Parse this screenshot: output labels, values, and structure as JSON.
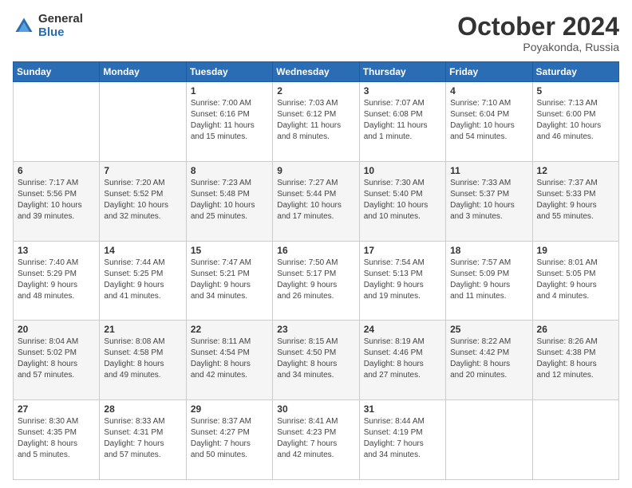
{
  "logo": {
    "general": "General",
    "blue": "Blue"
  },
  "header": {
    "month": "October 2024",
    "location": "Poyakonda, Russia"
  },
  "weekdays": [
    "Sunday",
    "Monday",
    "Tuesday",
    "Wednesday",
    "Thursday",
    "Friday",
    "Saturday"
  ],
  "weeks": [
    [
      {
        "day": "",
        "info": ""
      },
      {
        "day": "",
        "info": ""
      },
      {
        "day": "1",
        "info": "Sunrise: 7:00 AM\nSunset: 6:16 PM\nDaylight: 11 hours\nand 15 minutes."
      },
      {
        "day": "2",
        "info": "Sunrise: 7:03 AM\nSunset: 6:12 PM\nDaylight: 11 hours\nand 8 minutes."
      },
      {
        "day": "3",
        "info": "Sunrise: 7:07 AM\nSunset: 6:08 PM\nDaylight: 11 hours\nand 1 minute."
      },
      {
        "day": "4",
        "info": "Sunrise: 7:10 AM\nSunset: 6:04 PM\nDaylight: 10 hours\nand 54 minutes."
      },
      {
        "day": "5",
        "info": "Sunrise: 7:13 AM\nSunset: 6:00 PM\nDaylight: 10 hours\nand 46 minutes."
      }
    ],
    [
      {
        "day": "6",
        "info": "Sunrise: 7:17 AM\nSunset: 5:56 PM\nDaylight: 10 hours\nand 39 minutes."
      },
      {
        "day": "7",
        "info": "Sunrise: 7:20 AM\nSunset: 5:52 PM\nDaylight: 10 hours\nand 32 minutes."
      },
      {
        "day": "8",
        "info": "Sunrise: 7:23 AM\nSunset: 5:48 PM\nDaylight: 10 hours\nand 25 minutes."
      },
      {
        "day": "9",
        "info": "Sunrise: 7:27 AM\nSunset: 5:44 PM\nDaylight: 10 hours\nand 17 minutes."
      },
      {
        "day": "10",
        "info": "Sunrise: 7:30 AM\nSunset: 5:40 PM\nDaylight: 10 hours\nand 10 minutes."
      },
      {
        "day": "11",
        "info": "Sunrise: 7:33 AM\nSunset: 5:37 PM\nDaylight: 10 hours\nand 3 minutes."
      },
      {
        "day": "12",
        "info": "Sunrise: 7:37 AM\nSunset: 5:33 PM\nDaylight: 9 hours\nand 55 minutes."
      }
    ],
    [
      {
        "day": "13",
        "info": "Sunrise: 7:40 AM\nSunset: 5:29 PM\nDaylight: 9 hours\nand 48 minutes."
      },
      {
        "day": "14",
        "info": "Sunrise: 7:44 AM\nSunset: 5:25 PM\nDaylight: 9 hours\nand 41 minutes."
      },
      {
        "day": "15",
        "info": "Sunrise: 7:47 AM\nSunset: 5:21 PM\nDaylight: 9 hours\nand 34 minutes."
      },
      {
        "day": "16",
        "info": "Sunrise: 7:50 AM\nSunset: 5:17 PM\nDaylight: 9 hours\nand 26 minutes."
      },
      {
        "day": "17",
        "info": "Sunrise: 7:54 AM\nSunset: 5:13 PM\nDaylight: 9 hours\nand 19 minutes."
      },
      {
        "day": "18",
        "info": "Sunrise: 7:57 AM\nSunset: 5:09 PM\nDaylight: 9 hours\nand 11 minutes."
      },
      {
        "day": "19",
        "info": "Sunrise: 8:01 AM\nSunset: 5:05 PM\nDaylight: 9 hours\nand 4 minutes."
      }
    ],
    [
      {
        "day": "20",
        "info": "Sunrise: 8:04 AM\nSunset: 5:02 PM\nDaylight: 8 hours\nand 57 minutes."
      },
      {
        "day": "21",
        "info": "Sunrise: 8:08 AM\nSunset: 4:58 PM\nDaylight: 8 hours\nand 49 minutes."
      },
      {
        "day": "22",
        "info": "Sunrise: 8:11 AM\nSunset: 4:54 PM\nDaylight: 8 hours\nand 42 minutes."
      },
      {
        "day": "23",
        "info": "Sunrise: 8:15 AM\nSunset: 4:50 PM\nDaylight: 8 hours\nand 34 minutes."
      },
      {
        "day": "24",
        "info": "Sunrise: 8:19 AM\nSunset: 4:46 PM\nDaylight: 8 hours\nand 27 minutes."
      },
      {
        "day": "25",
        "info": "Sunrise: 8:22 AM\nSunset: 4:42 PM\nDaylight: 8 hours\nand 20 minutes."
      },
      {
        "day": "26",
        "info": "Sunrise: 8:26 AM\nSunset: 4:38 PM\nDaylight: 8 hours\nand 12 minutes."
      }
    ],
    [
      {
        "day": "27",
        "info": "Sunrise: 8:30 AM\nSunset: 4:35 PM\nDaylight: 8 hours\nand 5 minutes."
      },
      {
        "day": "28",
        "info": "Sunrise: 8:33 AM\nSunset: 4:31 PM\nDaylight: 7 hours\nand 57 minutes."
      },
      {
        "day": "29",
        "info": "Sunrise: 8:37 AM\nSunset: 4:27 PM\nDaylight: 7 hours\nand 50 minutes."
      },
      {
        "day": "30",
        "info": "Sunrise: 8:41 AM\nSunset: 4:23 PM\nDaylight: 7 hours\nand 42 minutes."
      },
      {
        "day": "31",
        "info": "Sunrise: 8:44 AM\nSunset: 4:19 PM\nDaylight: 7 hours\nand 34 minutes."
      },
      {
        "day": "",
        "info": ""
      },
      {
        "day": "",
        "info": ""
      }
    ]
  ]
}
